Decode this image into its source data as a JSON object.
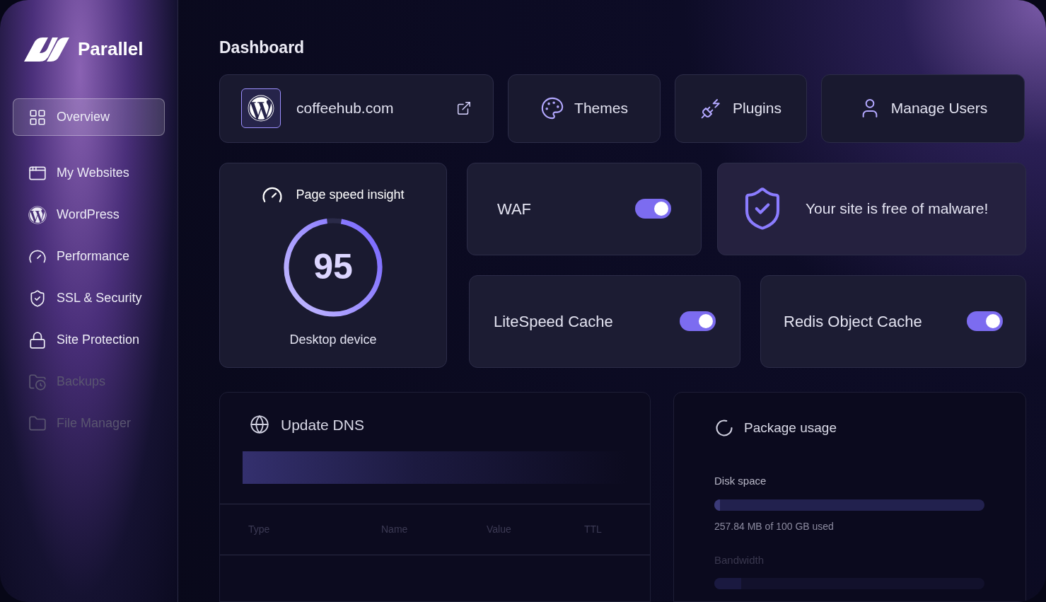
{
  "brand": {
    "name": "Parallel"
  },
  "sidebar": {
    "items": [
      {
        "label": "Overview",
        "selected": true,
        "disabled": false
      },
      {
        "label": "My Websites",
        "selected": false,
        "disabled": false
      },
      {
        "label": "WordPress",
        "selected": false,
        "disabled": false
      },
      {
        "label": "Performance",
        "selected": false,
        "disabled": false
      },
      {
        "label": "SSL & Security",
        "selected": false,
        "disabled": false
      },
      {
        "label": "Site Protection",
        "selected": false,
        "disabled": false
      },
      {
        "label": "Backups",
        "selected": false,
        "disabled": true
      },
      {
        "label": "File Manager",
        "selected": false,
        "disabled": true
      }
    ]
  },
  "page": {
    "title": "Dashboard"
  },
  "quick_links": [
    {
      "kind": "site",
      "label": "coffeehub.com"
    },
    {
      "kind": "themes",
      "label": "Themes"
    },
    {
      "kind": "plugins",
      "label": "Plugins"
    },
    {
      "kind": "users",
      "label": "Manage Users"
    }
  ],
  "page_speed": {
    "title": "Page speed insight",
    "score": "95",
    "level": 0.95,
    "caption": "Desktop device"
  },
  "toggles": [
    {
      "label": "WAF",
      "on": true
    },
    {
      "label": "LiteSpeed Cache",
      "on": true
    },
    {
      "label": "Redis Object Cache",
      "on": true
    }
  ],
  "malware": {
    "message": "Your site is free of malware!"
  },
  "dns": {
    "title": "Update DNS",
    "columns": [
      "Type",
      "Name",
      "Value",
      "TTL"
    ]
  },
  "package": {
    "title": "Package usage",
    "meters": [
      {
        "label": "Disk space",
        "level": 0.02,
        "reading": "257.84 MB of 100 GB used",
        "faded": false
      },
      {
        "label": "Bandwidth",
        "level": 0.1,
        "faded": true
      }
    ]
  }
}
